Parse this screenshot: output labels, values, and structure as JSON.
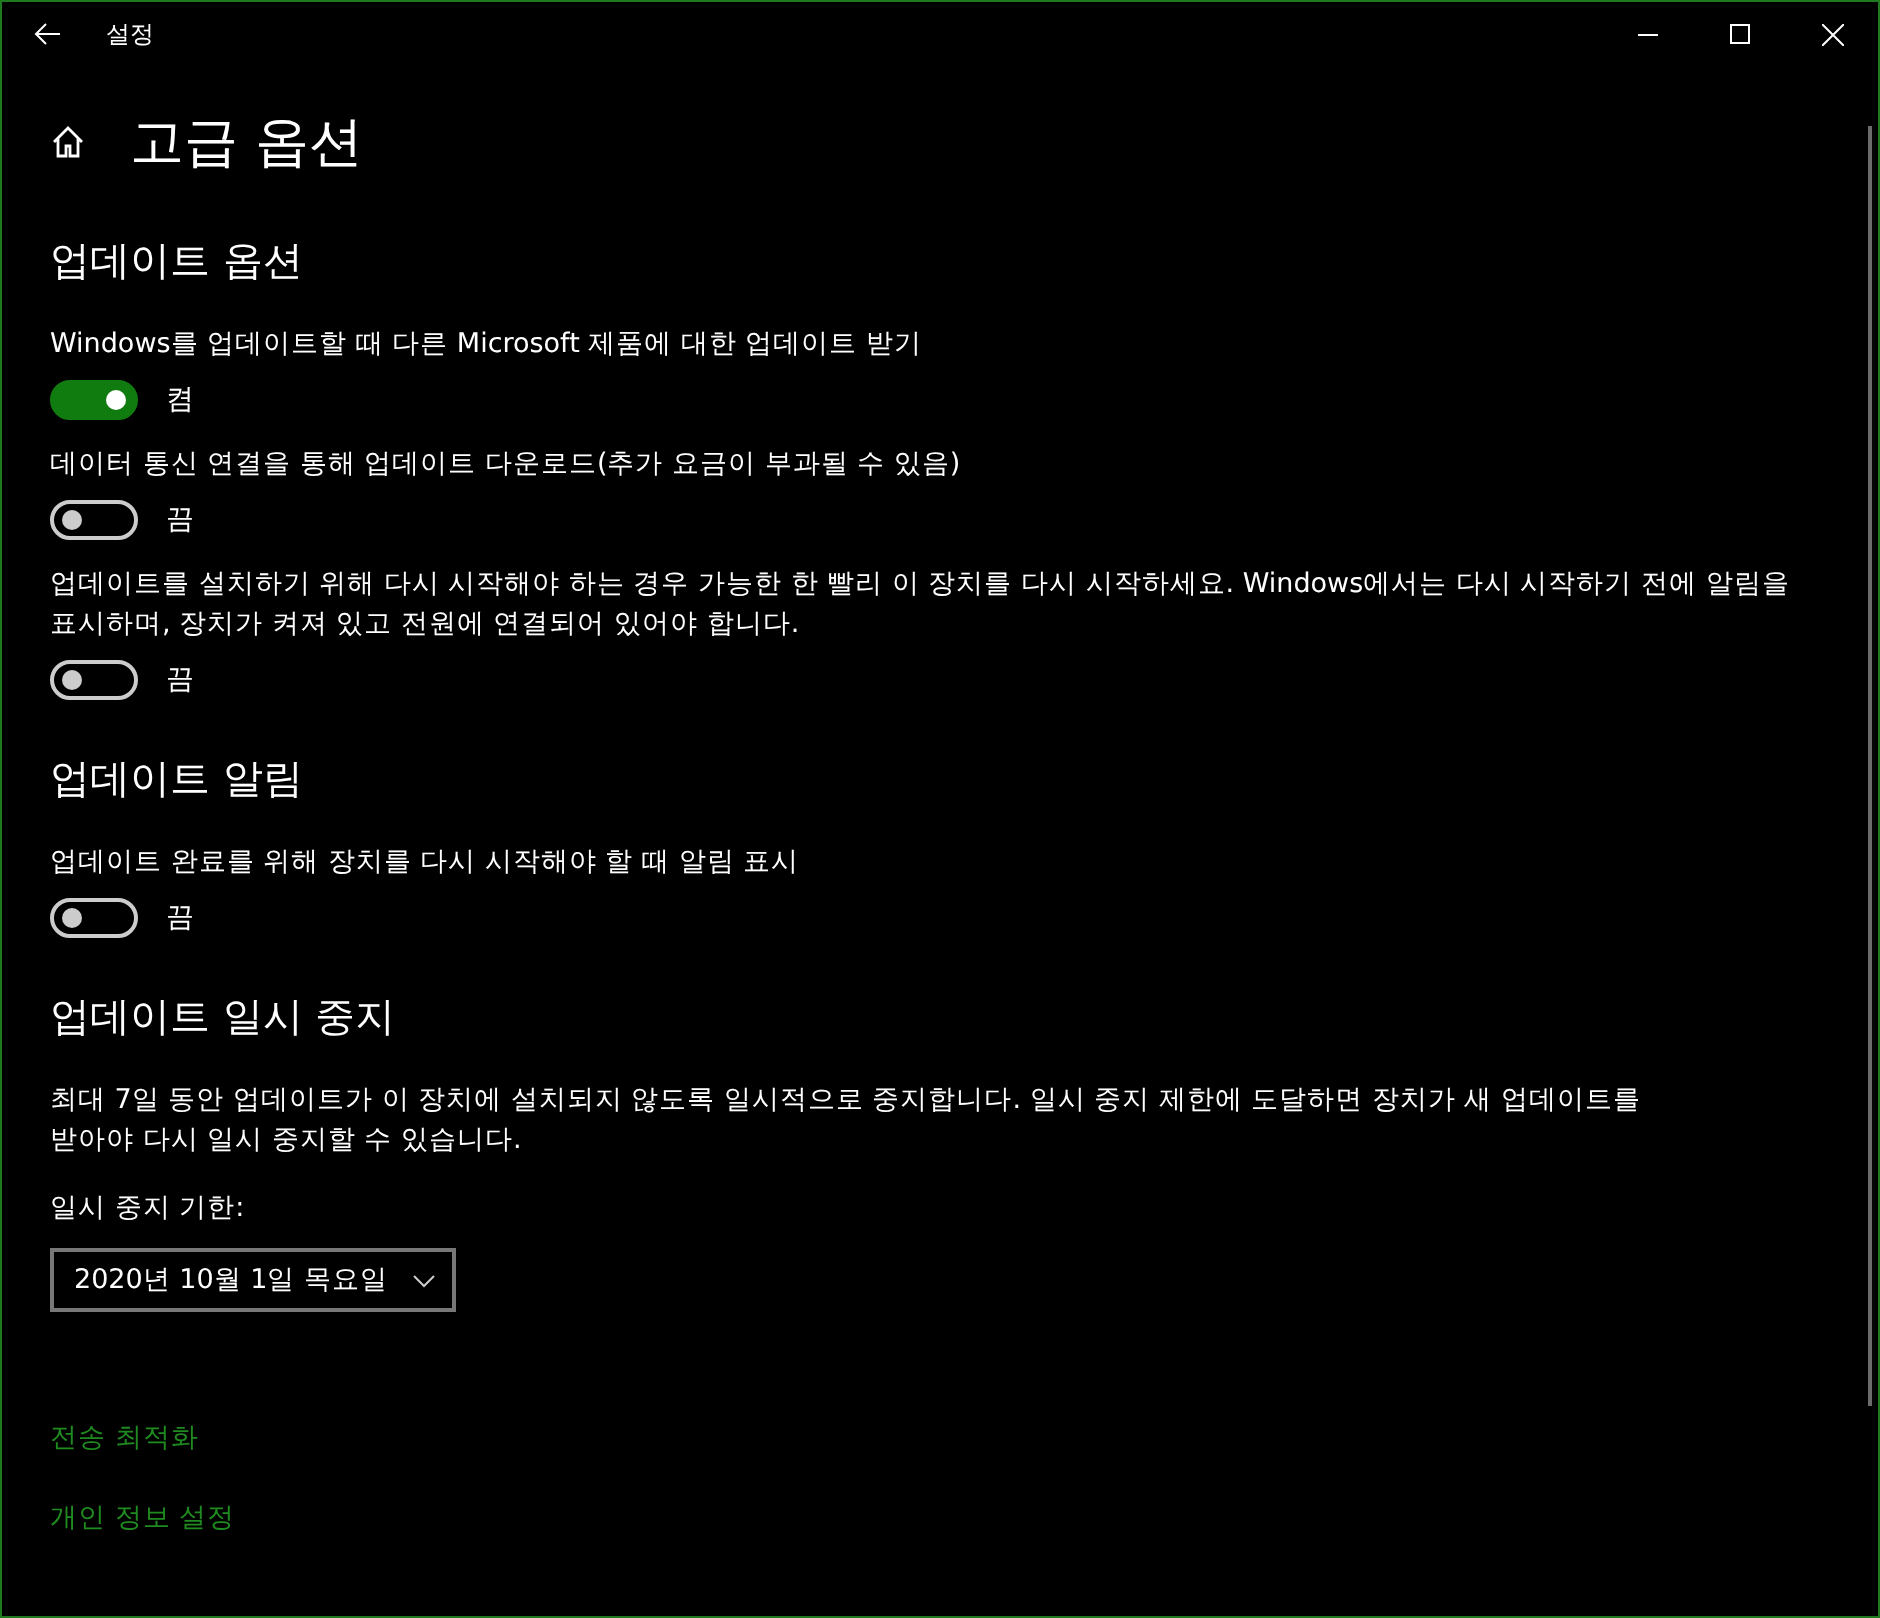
{
  "window": {
    "title": "설정"
  },
  "page": {
    "title": "고급 옵션"
  },
  "sections": [
    {
      "title": "업데이트 옵션",
      "items": [
        {
          "kind": "toggle",
          "label": "Windows를 업데이트할 때 다른 Microsoft 제품에 대한 업데이트 받기",
          "on": true,
          "state_text": "켬"
        },
        {
          "kind": "toggle",
          "label": "데이터 통신 연결을 통해 업데이트 다운로드(추가 요금이 부과될 수 있음)",
          "on": false,
          "state_text": "끔"
        },
        {
          "kind": "toggle",
          "label": "업데이트를 설치하기 위해 다시 시작해야 하는 경우 가능한 한 빨리 이 장치를 다시 시작하세요. Windows에서는 다시 시작하기 전에 알림을 표시하며, 장치가 켜져 있고 전원에 연결되어 있어야 합니다.",
          "on": false,
          "state_text": "끔"
        }
      ]
    },
    {
      "title": "업데이트 알림",
      "items": [
        {
          "kind": "toggle",
          "label": "업데이트 완료를 위해 장치를 다시 시작해야 할 때 알림 표시",
          "on": false,
          "state_text": "끔"
        }
      ]
    },
    {
      "title": "업데이트 일시 중지",
      "items": [
        {
          "kind": "paragraph",
          "text": "최대 7일 동안 업데이트가 이 장치에 설치되지 않도록 일시적으로 중지합니다. 일시 중지 제한에 도달하면 장치가 새 업데이트를 받아야 다시 일시 중지할 수 있습니다."
        },
        {
          "kind": "dropdown",
          "label": "일시 중지 기한:",
          "value": "2020년 10월 1일 목요일"
        }
      ]
    }
  ],
  "links": [
    "전송 최적화",
    "개인 정보 설정"
  ]
}
